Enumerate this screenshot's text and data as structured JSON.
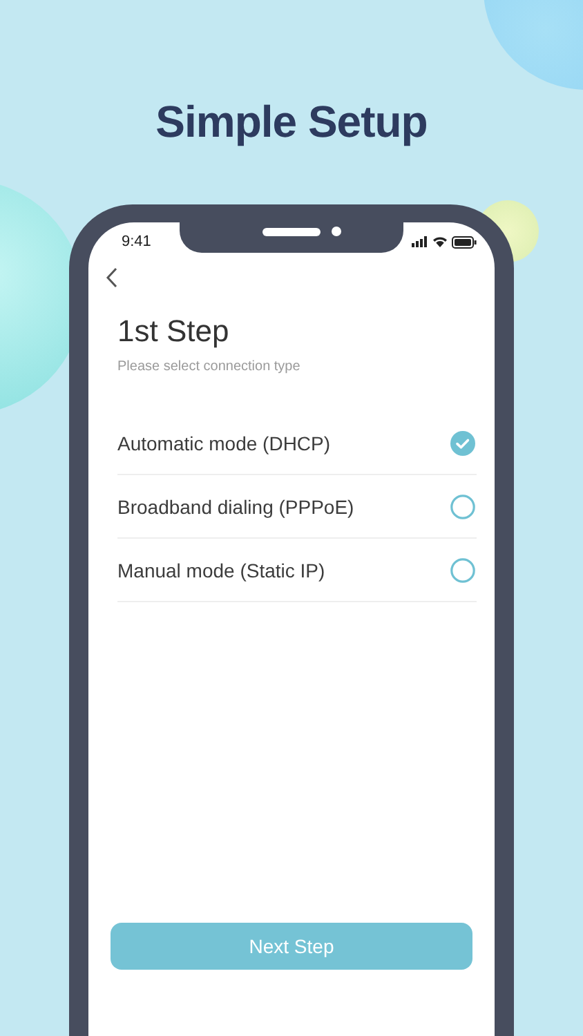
{
  "headline": "Simple Setup",
  "status_bar": {
    "time": "9:41"
  },
  "screen": {
    "title": "1st Step",
    "subtitle": "Please select connection type",
    "options": [
      {
        "label": "Automatic mode (DHCP)",
        "selected": true
      },
      {
        "label": "Broadband dialing (PPPoE)",
        "selected": false
      },
      {
        "label": "Manual mode (Static IP)",
        "selected": false
      }
    ],
    "button": "Next Step"
  }
}
